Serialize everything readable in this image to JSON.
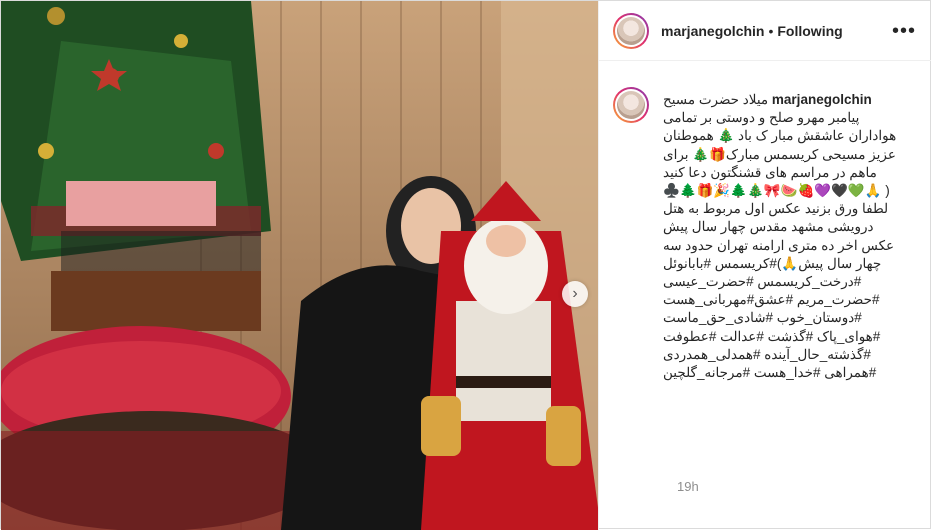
{
  "post": {
    "username": "marjanegolchin",
    "separator": "•",
    "follow_status": "Following",
    "more_icon": "•••",
    "caption": "میلاد حضرت مسیح\nپیامبر مهرو صلح و دوستی بر تمامی\nهواداران عاشقش مبار ک باد 🎄 هموطنان\nعزیز مسیحی کریسمس مبارک🎁🎄 برای\nماهم در مراسم های قشنگتون دعا کنید\n( 🙏💚🖤💜🍓🍉🎀🎄🌲🎉🎁🌲♣️\nلطفا ورق بزنید عکس اول مربوط به هتل\nدرویشی مشهد مقدس چهار سال پیش\nعکس اخر ده متری ارامنه تهران حدود سه\nچهار سال پیش🙏)#کریسمس #بابانوئل\n#درخت_کریسمس #حضرت_عیسی\n#حضرت_مریم #عشق#مهربانی_هست\n#دوستان_خوب #شادی_حق_ماست\n#هوای_پاک #گذشت #عدالت #عطوفت\n#گذشته_حال_آینده #همدلی_همدردی\n#همراهی #خدا_هست #مرجانه_گلچین",
    "time": "19h",
    "next_icon": "›"
  }
}
